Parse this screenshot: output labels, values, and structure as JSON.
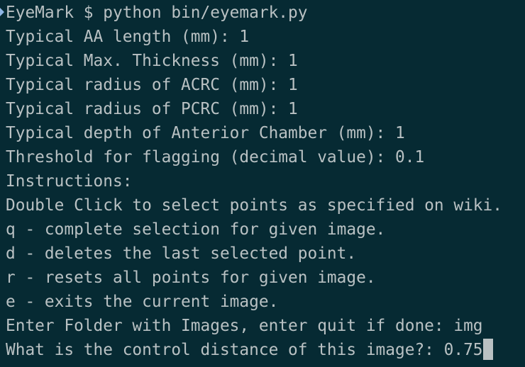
{
  "terminal": {
    "colors": {
      "background": "#062a33",
      "text": "#b9c1c3",
      "prompt_marker": "#8fb6e6",
      "cursor": "#b9c1c3"
    },
    "prompt_line": {
      "prompt": "EyeMark $ ",
      "command": "python bin/eyemark.py"
    },
    "lines": [
      "Typical AA length (mm): 1",
      "Typical Max. Thickness (mm): 1",
      "Typical radius of ACRC (mm): 1",
      "Typical radius of PCRC (mm): 1",
      "Typical depth of Anterior Chamber (mm): 1",
      "Threshold for flagging (decimal value): 0.1",
      "Instructions:",
      "Double Click to select points as specified on wiki.",
      "q - complete selection for given image.",
      "d - deletes the last selected point.",
      "r - resets all points for given image.",
      "e - exits the current image.",
      "Enter Folder with Images, enter quit if done: img"
    ],
    "input_line": {
      "question": "What is the control distance of this image?: ",
      "value": "0.75"
    }
  }
}
